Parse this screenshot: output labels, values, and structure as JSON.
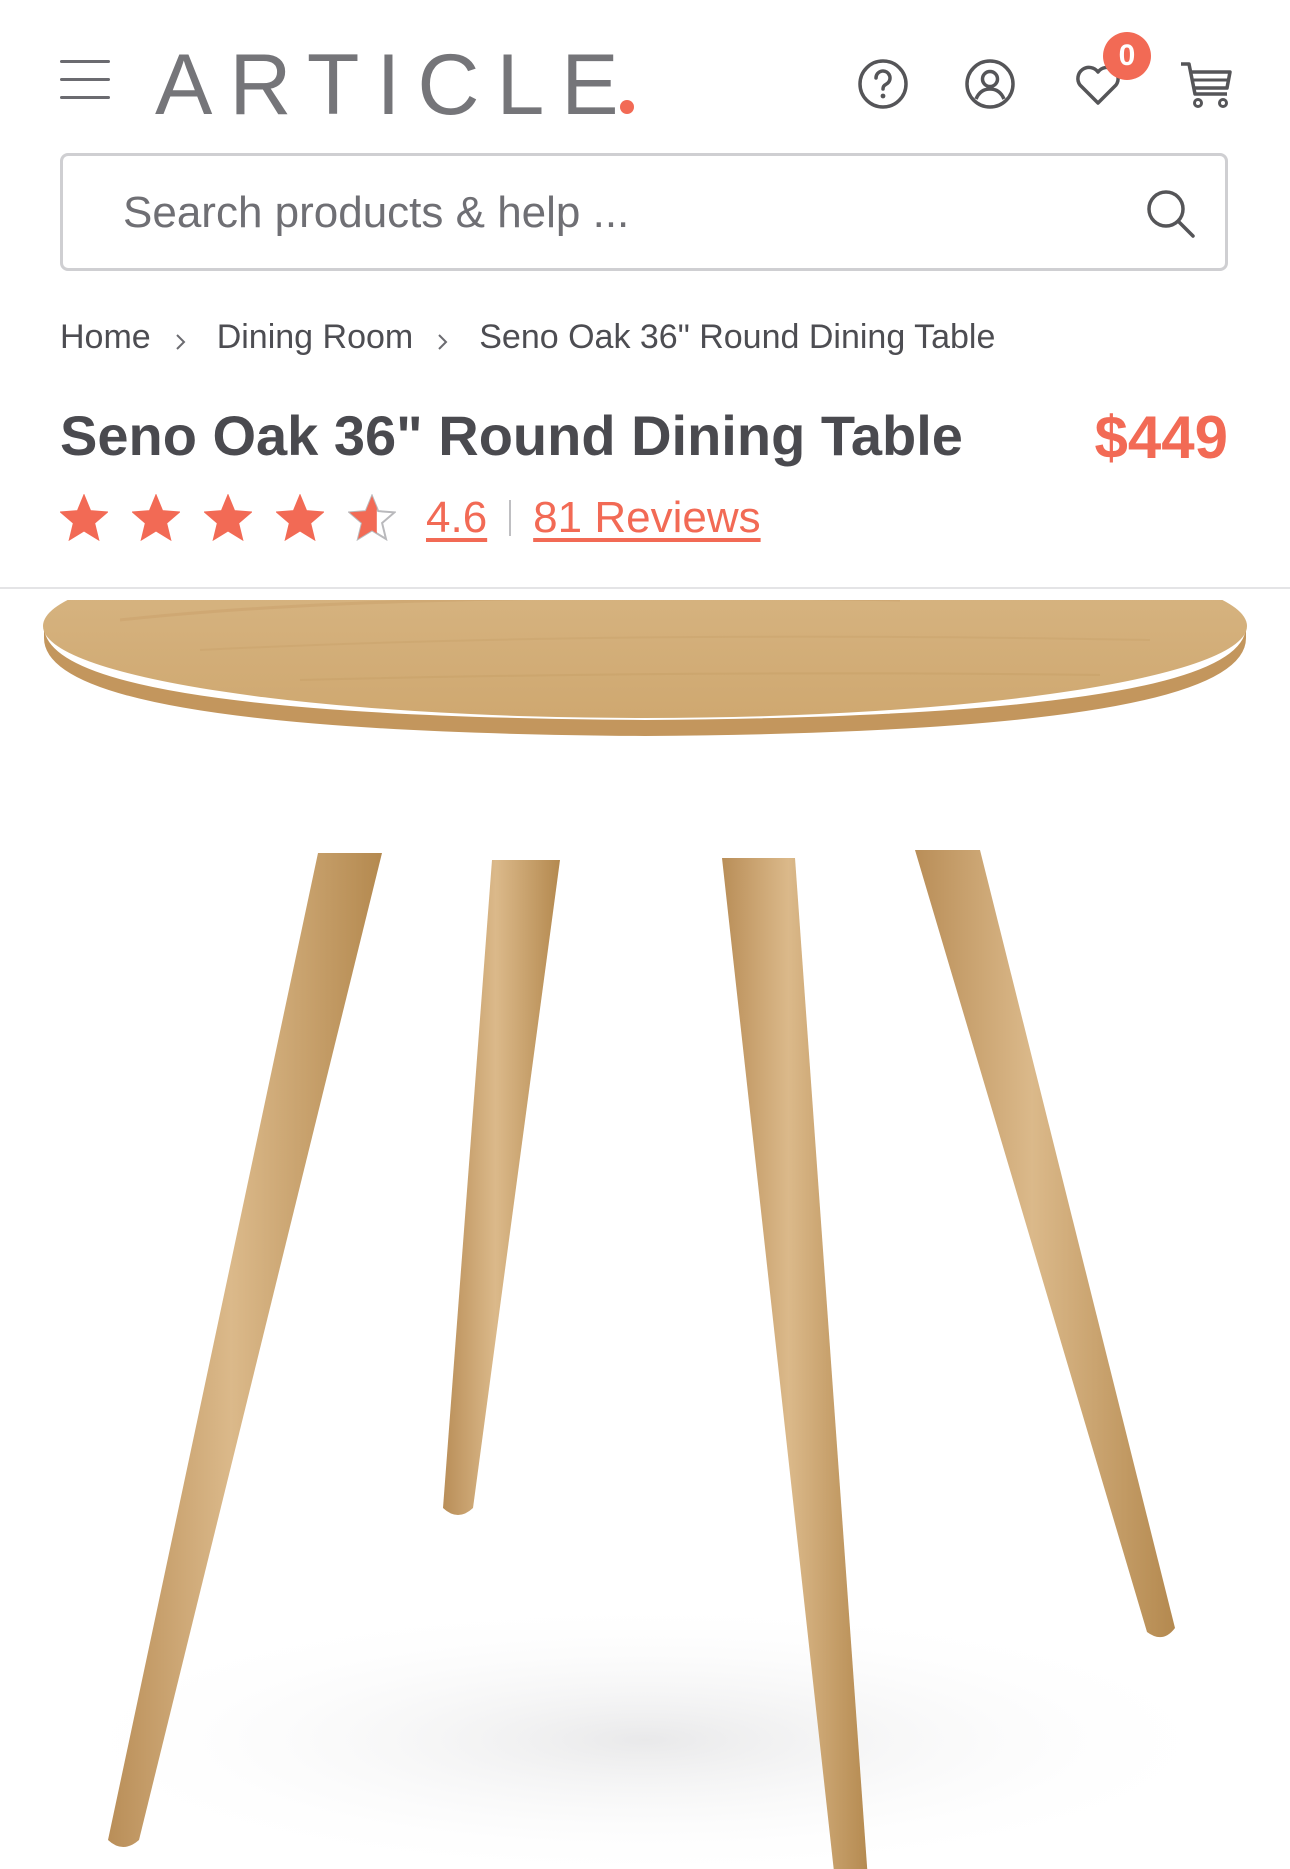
{
  "header": {
    "logo": "ARTICLE",
    "wishlist_count": "0",
    "brand_color": "#f26a55",
    "icons": [
      "menu-icon",
      "help-icon",
      "account-icon",
      "wishlist-icon",
      "cart-icon"
    ]
  },
  "search": {
    "placeholder": "Search products & help ..."
  },
  "breadcrumb": {
    "items": [
      "Home",
      "Dining Room",
      "Seno Oak 36\" Round Dining Table"
    ]
  },
  "product": {
    "title": "Seno Oak 36\" Round Dining Table",
    "price": "$449",
    "rating": "4.6",
    "rating_fraction_of_5": 0.92,
    "reviews_label": "81 Reviews",
    "image": "seno-oak-round-dining-table"
  }
}
